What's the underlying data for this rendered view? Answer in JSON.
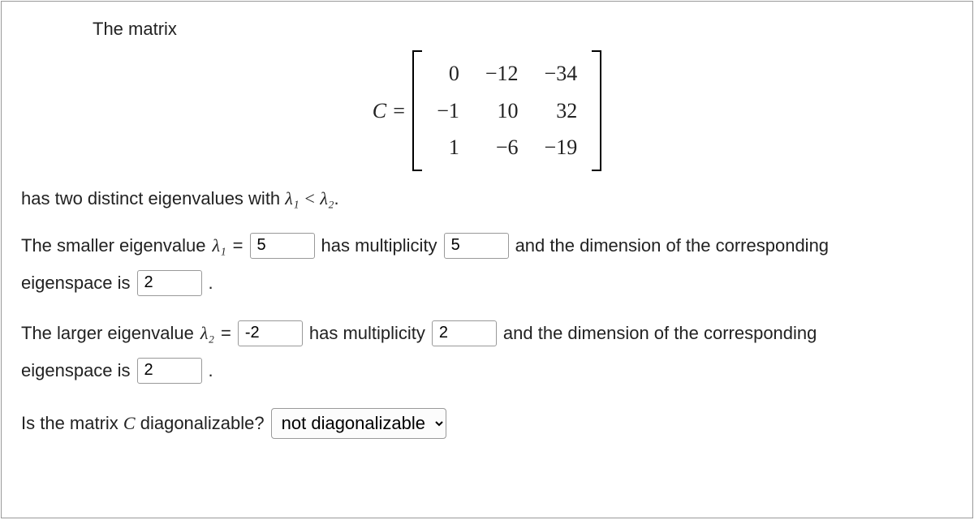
{
  "intro": "The matrix",
  "matrix": {
    "label": "C =",
    "rows": [
      [
        "0",
        "−12",
        "−34"
      ],
      [
        "−1",
        "10",
        "32"
      ],
      [
        "1",
        "−6",
        "−19"
      ]
    ]
  },
  "distinct_line_pre": "has two distinct eigenvalues with ",
  "distinct_line_math": "λ₁ < λ₂",
  "distinct_line_post": ".",
  "q1": {
    "pre": "The smaller eigenvalue ",
    "sym": "λ₁",
    "eq": " = ",
    "val": "5",
    "mult_pre": "has multiplicity",
    "mult_val": "5",
    "dim_pre": "and the dimension of the corresponding",
    "eig_pre": "eigenspace is",
    "eig_val": "2",
    "period": "."
  },
  "q2": {
    "pre": "The larger eigenvalue ",
    "sym": "λ₂",
    "eq": " = ",
    "val": "-2",
    "mult_pre": "has multiplicity",
    "mult_val": "2",
    "dim_pre": "and the dimension of the corresponding",
    "eig_pre": "eigenspace is",
    "eig_val": "2",
    "period": "."
  },
  "diag": {
    "question_pre": "Is the matrix ",
    "question_sym": "C",
    "question_post": " diagonalizable?",
    "selected": "not diagonalizable",
    "options": [
      "not diagonalizable"
    ]
  }
}
